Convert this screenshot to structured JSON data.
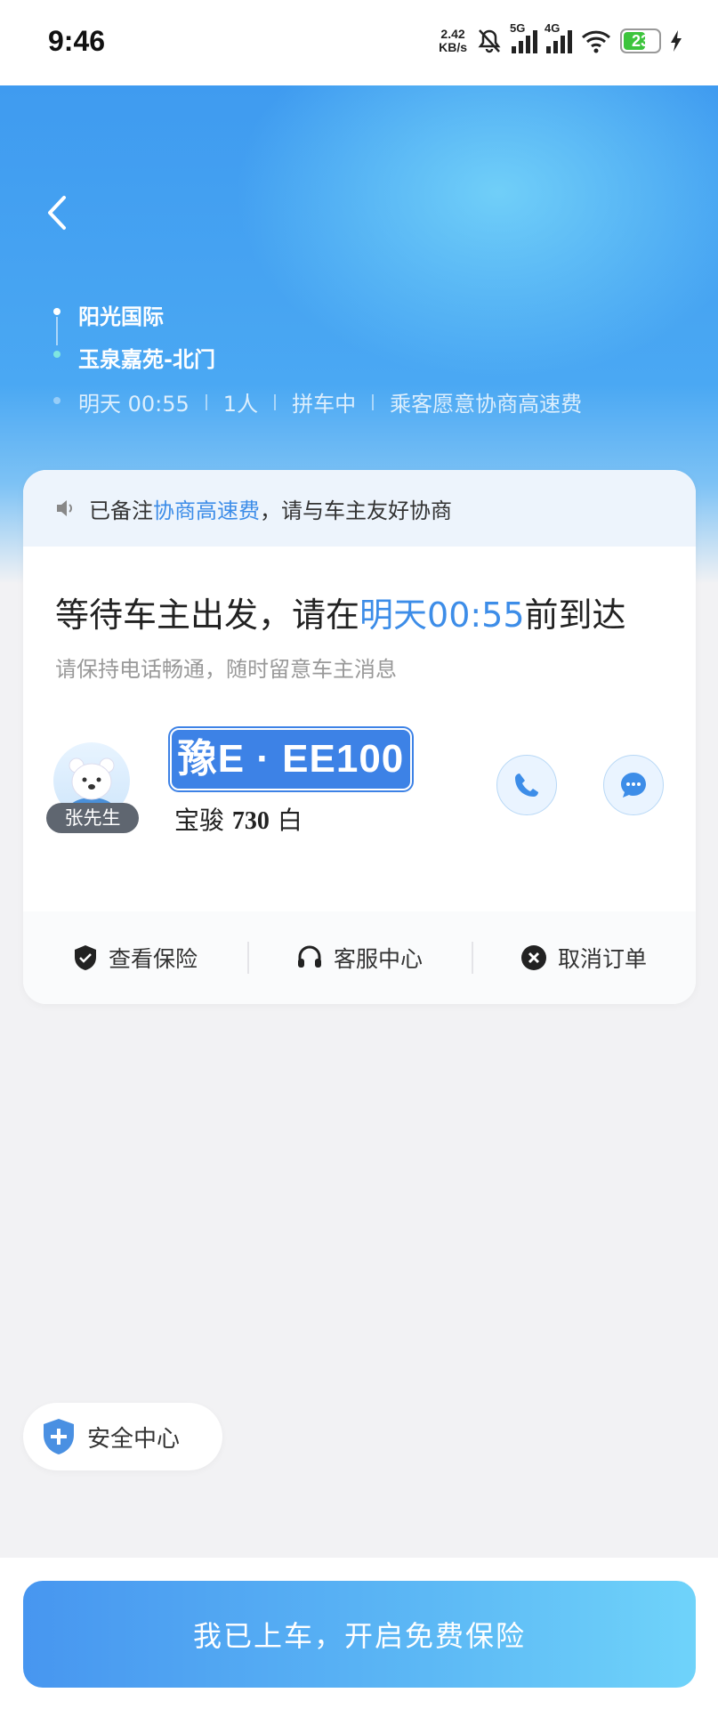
{
  "status_bar": {
    "time": "9:46",
    "net_speed_value": "2.42",
    "net_speed_unit": "KB/s",
    "sim1_label": "5G",
    "sim2_label": "4G",
    "battery": "23"
  },
  "route": {
    "start": "阳光国际",
    "end": "玉泉嘉苑-北门",
    "depart_time": "明天 00:55",
    "passengers": "1人",
    "ride_type": "拼车中",
    "note": "乘客愿意协商高速费"
  },
  "notice": {
    "prefix": "已备注",
    "highlight": "协商高速费",
    "suffix": "，请与车主友好协商"
  },
  "status": {
    "title_prefix": "等待车主出发，请在",
    "title_time": "明天00:55",
    "title_suffix": "前到达",
    "subtitle": "请保持电话畅通，随时留意车主消息"
  },
  "driver": {
    "name": "张先生",
    "plate": "豫E · EE100",
    "car_brand": "宝骏",
    "car_model_no": "730",
    "car_color": "白"
  },
  "actions": {
    "insurance": "查看保险",
    "service": "客服中心",
    "cancel": "取消订单"
  },
  "safety_center": "安全中心",
  "board_button": "我已上车，开启免费保险",
  "colors": {
    "accent": "#3d8de8",
    "plate_bg": "#3d82e6",
    "battery": "#3cc43c"
  }
}
